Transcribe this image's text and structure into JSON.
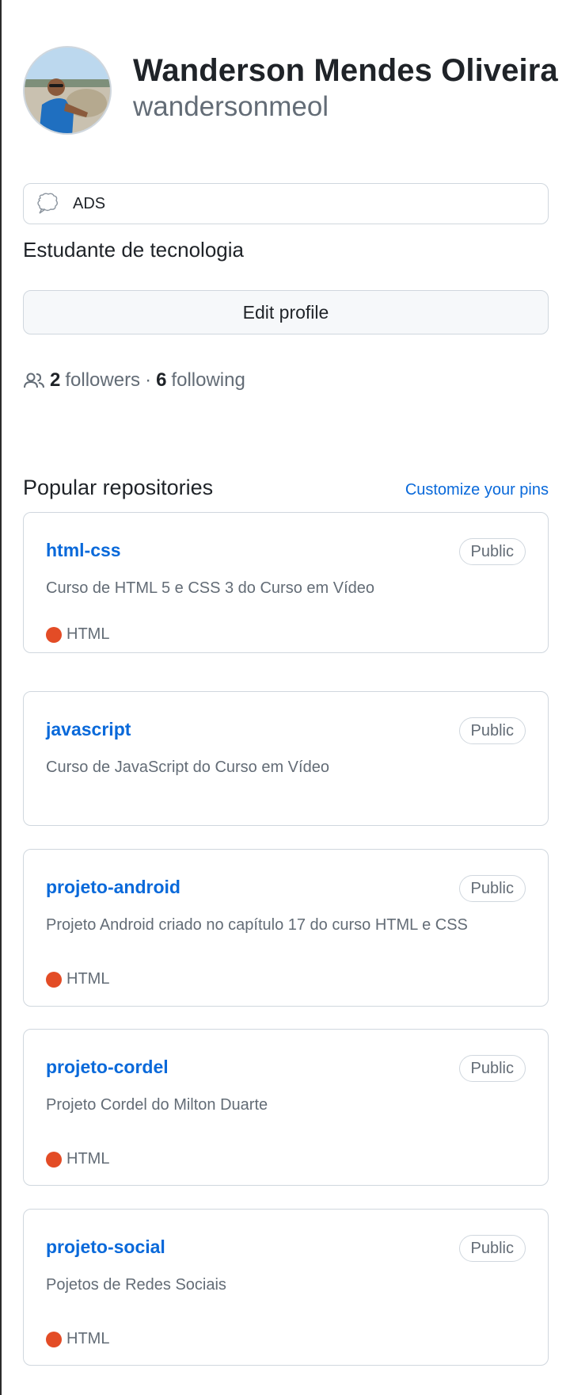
{
  "profile": {
    "full_name": "Wanderson Mendes Oliveira",
    "login": "wandersonmeol"
  },
  "status": {
    "emoji_icon": "speech-bubble-icon",
    "text": "ADS"
  },
  "bio": "Estudante de tecnologia",
  "edit_profile_label": "Edit profile",
  "follow": {
    "icon": "people-icon",
    "followers_count": "2",
    "followers_label": "followers",
    "separator": "·",
    "following_count": "6",
    "following_label": "following"
  },
  "popular": {
    "title": "Popular repositories",
    "customize_label": "Customize your pins",
    "repos": [
      {
        "name": "html-css",
        "visibility": "Public",
        "description": "Curso de HTML 5 e CSS 3 do Curso em Vídeo",
        "language": "HTML"
      },
      {
        "name": "javascript",
        "visibility": "Public",
        "description": "Curso de JavaScript do Curso em Vídeo",
        "language": ""
      },
      {
        "name": "projeto-android",
        "visibility": "Public",
        "description": "Projeto Android criado no capítulo 17 do curso HTML e CSS",
        "language": "HTML"
      },
      {
        "name": "projeto-cordel",
        "visibility": "Public",
        "description": "Projeto Cordel do Milton Duarte",
        "language": "HTML"
      },
      {
        "name": "projeto-social",
        "visibility": "Public",
        "description": "Pojetos de Redes Sociais",
        "language": "HTML"
      }
    ]
  },
  "colors": {
    "link": "#0969da",
    "muted": "#636c76",
    "border": "#d0d7de",
    "html_language": "#e34c26"
  }
}
